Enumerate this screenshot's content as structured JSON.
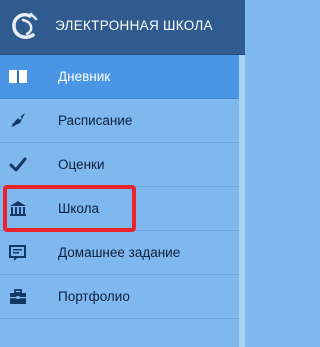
{
  "header": {
    "title": "ЭЛЕКТРОННАЯ ШКОЛА",
    "logo_icon": "school-logo-icon"
  },
  "menu": {
    "items": [
      {
        "label": "Дневник",
        "icon": "book-icon",
        "active": true
      },
      {
        "label": "Расписание",
        "icon": "rocket-icon",
        "active": false
      },
      {
        "label": "Оценки",
        "icon": "checkmark-icon",
        "active": false
      },
      {
        "label": "Школа",
        "icon": "bank-building-icon",
        "active": false
      },
      {
        "label": "Домашнее задание",
        "icon": "homework-icon",
        "active": false
      },
      {
        "label": "Портфолио",
        "icon": "briefcase-icon",
        "active": false
      }
    ]
  },
  "colors": {
    "header_bg": "#2f5b8e",
    "active_bg": "#4a95e4",
    "item_bg": "#7fb8ee",
    "highlight": "#e8242a"
  }
}
